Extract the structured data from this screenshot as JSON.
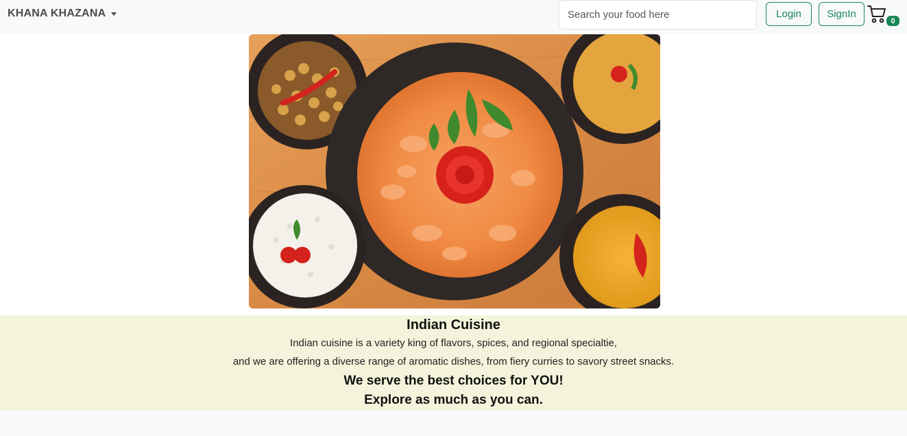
{
  "navbar": {
    "brand": "KHANA KHAZANA",
    "search_placeholder": "Search your food here",
    "login_label": "Login",
    "signin_label": "SignIn",
    "cart_count": "0"
  },
  "info": {
    "title": "Indian Cuisine",
    "line1": "Indian cuisine is a variety king of flavors, spices, and regional specialtie,",
    "line2": "and we are offering a diverse range of aromatic dishes, from fiery curries to savory street snacks.",
    "tagline1": "We serve the best choices for YOU!",
    "tagline2": "Explore as much as you can."
  },
  "colors": {
    "accent": "#198754",
    "info_bg": "#f4f4dc",
    "nav_bg": "#f8f9fa"
  }
}
